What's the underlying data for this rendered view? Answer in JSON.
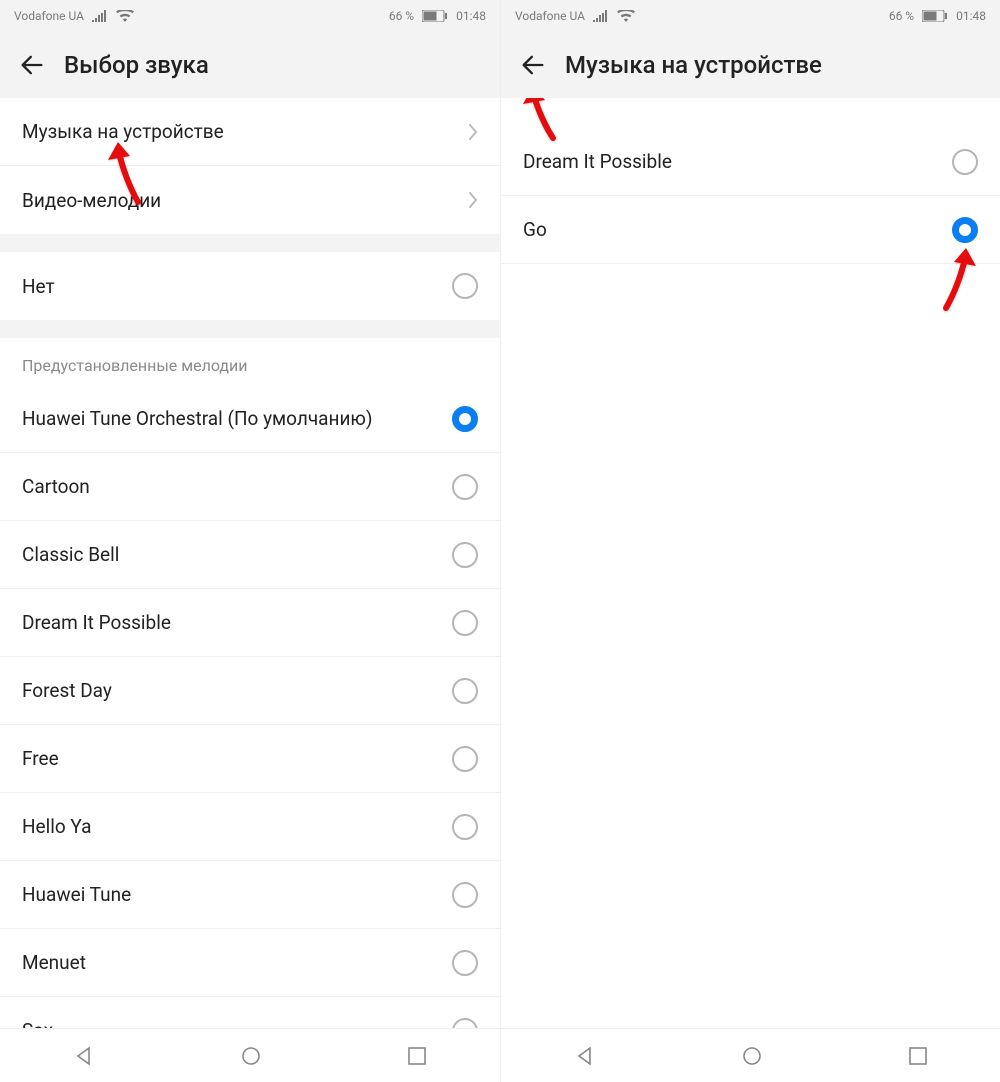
{
  "status": {
    "carrier": "Vodafone UA",
    "battery_pct": "66 %",
    "time": "01:48"
  },
  "left": {
    "title": "Выбор звука",
    "nav_rows": [
      {
        "label": "Музыка на устройстве"
      },
      {
        "label": "Видео-мелодии"
      }
    ],
    "none_label": "Нет",
    "section_header": "Предустановленные мелодии",
    "ringtones": [
      {
        "label": "Huawei Tune Orchestral (По умолчанию)",
        "selected": true
      },
      {
        "label": "Cartoon",
        "selected": false
      },
      {
        "label": "Classic Bell",
        "selected": false
      },
      {
        "label": "Dream It Possible",
        "selected": false
      },
      {
        "label": "Forest Day",
        "selected": false
      },
      {
        "label": "Free",
        "selected": false
      },
      {
        "label": "Hello Ya",
        "selected": false
      },
      {
        "label": "Huawei Tune",
        "selected": false
      },
      {
        "label": "Menuet",
        "selected": false
      },
      {
        "label": "Sax",
        "selected": false
      }
    ]
  },
  "right": {
    "title": "Музыка на устройстве",
    "tracks": [
      {
        "label": "Dream It Possible",
        "selected": false
      },
      {
        "label": "Go",
        "selected": true
      }
    ]
  }
}
